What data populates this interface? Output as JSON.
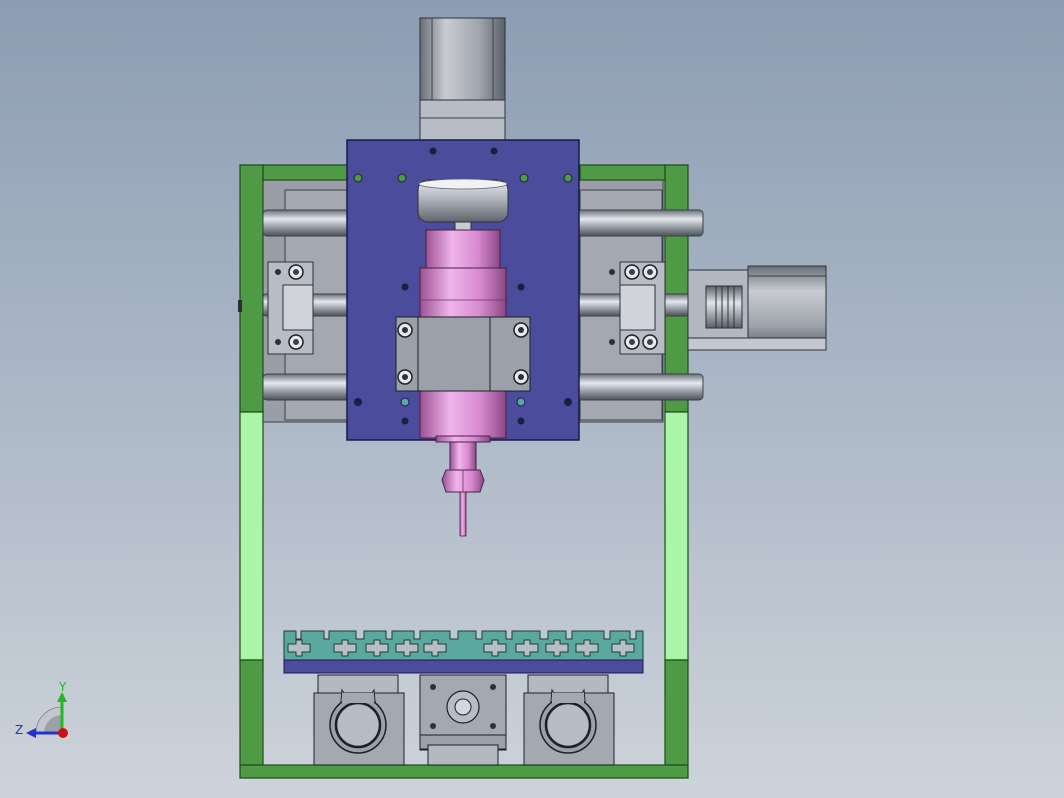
{
  "viewport": {
    "background_top": "#8c9db3",
    "background_bottom": "#cdd3da"
  },
  "colors": {
    "frame_green": "#4e9a45",
    "frame_green_dark": "#2d6a28",
    "frame_green_light": "#aaf5a7",
    "plate_blue": "#4c4c9c",
    "plate_blue_edge": "#2a2a6a",
    "spindle_pink": "#d88ad0",
    "spindle_pink_dark": "#a45a9c",
    "steel": "#9aa0a8",
    "steel_dark": "#5c6068",
    "steel_light": "#d8dce2",
    "slot_teal": "#5aa8a0",
    "slot_teal_dark": "#2f6e68",
    "axis_y": "#22b822",
    "axis_z": "#2233cc",
    "axis_origin": "#cc1111"
  },
  "triad": {
    "y_label": "Y",
    "z_label": "Z",
    "y_icon": "y-axis-arrow-icon",
    "z_icon": "z-axis-arrow-icon",
    "origin_icon": "origin-dot-icon"
  }
}
